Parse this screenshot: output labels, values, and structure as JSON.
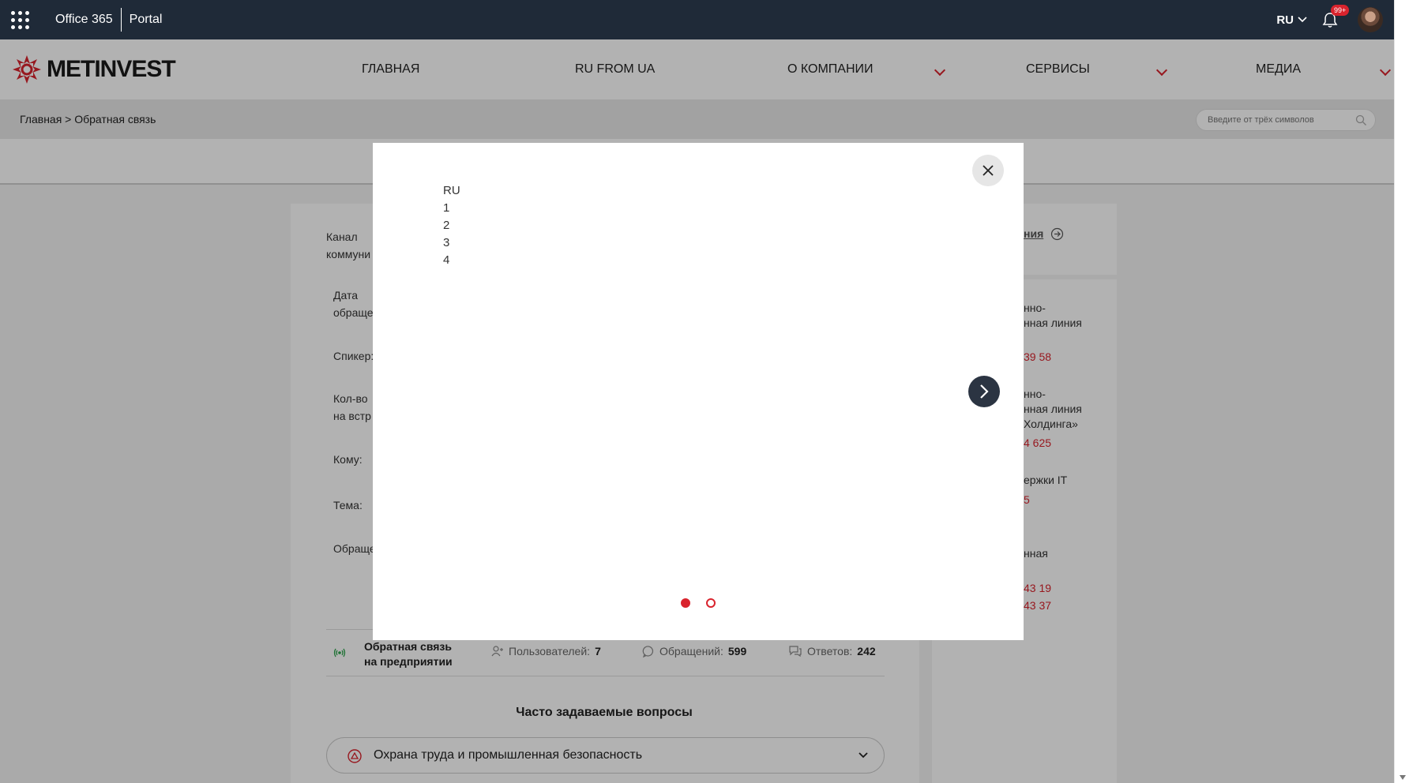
{
  "suitebar": {
    "app_title": "Office 365",
    "portal_label": "Portal",
    "language": "RU",
    "notifications_badge": "99+"
  },
  "header": {
    "logo_text": "METINVEST",
    "nav": [
      {
        "label": "ГЛАВНАЯ",
        "has_dropdown": false
      },
      {
        "label": "RU FROM UA",
        "has_dropdown": false
      },
      {
        "label": "О КОМПАНИИ",
        "has_dropdown": true
      },
      {
        "label": "СЕРВИСЫ",
        "has_dropdown": true
      },
      {
        "label": "МЕДИА",
        "has_dropdown": true
      }
    ]
  },
  "breadcrumb": {
    "text": "Главная > Обратная связь"
  },
  "search": {
    "placeholder": "Введите от трёх символов"
  },
  "form": {
    "labels": [
      "Канал",
      "коммуни",
      "Дата",
      "обраще",
      "Спикер:",
      "Кол-во",
      "на встр",
      "Кому:",
      "Тема:",
      "Обраще"
    ]
  },
  "side": {
    "link_fragment": "ния",
    "items": [
      "нно-",
      "нная линия",
      "39 58",
      "нно-",
      "нная линия",
      "Холдинга»",
      "4 625",
      "ержки IT",
      "5",
      "нная",
      "43 19",
      "43 37"
    ]
  },
  "stats": {
    "feedback_title_line1": "Обратная связь",
    "feedback_title_line2": "на предприятии",
    "users_label": "Пользователей:",
    "users_value": "7",
    "requests_label": "Обращений:",
    "requests_value": "599",
    "answers_label": "Ответов:",
    "answers_value": "242"
  },
  "faq": {
    "title": "Часто задаваемые вопросы",
    "items": [
      {
        "label": "Охрана труда и промышленная безопасность"
      }
    ]
  },
  "modal": {
    "lines": [
      "RU",
      "1",
      "2",
      "3",
      "4"
    ],
    "slide_count": 2,
    "active_slide": 1
  },
  "colors": {
    "accent": "#d9232d",
    "suitebar_bg": "#1f2a38",
    "next_button_bg": "#2b3442"
  }
}
